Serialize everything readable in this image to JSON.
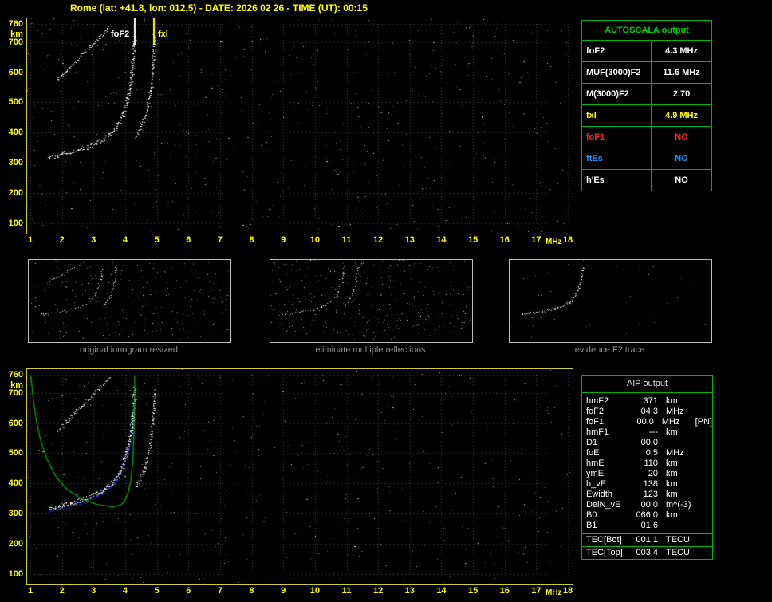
{
  "title": "Rome (lat: +41.8, lon: 012.5) - DATE: 2026 02 26 - TIME (UT): 00:15",
  "top_plot": {
    "foF2_label": "foF2",
    "fxl_label": "fxl",
    "x_unit": "MHz",
    "y_unit": "km"
  },
  "bottom_plot": {
    "x_unit": "MHz",
    "y_unit": "km"
  },
  "autoscala_table": {
    "title": "AUTOSCALA output",
    "rows": [
      {
        "label": "foF2",
        "value": "4.3 MHz",
        "color": "#ffffff"
      },
      {
        "label": "MUF(3000)F2",
        "value": "11.6 MHz",
        "color": "#ffffff"
      },
      {
        "label": "M(3000)F2",
        "value": "2.70",
        "color": "#ffffff"
      },
      {
        "label": "fxl",
        "value": "4.9 MHz",
        "color": "#ffff00"
      },
      {
        "label": "foF1",
        "value": "NO",
        "color": "#ff2222"
      },
      {
        "label": "ftEs",
        "value": "NO",
        "color": "#1e90ff"
      },
      {
        "label": "h'Es",
        "value": "NO",
        "color": "#ffffff"
      }
    ]
  },
  "mini_panels": [
    {
      "caption": "original ionogram resized"
    },
    {
      "caption": "eliminate multiple reflections"
    },
    {
      "caption": "evidence F2 trace"
    }
  ],
  "aip_table": {
    "title": "AIP output",
    "rows": [
      {
        "label": "hmF2",
        "value": "371",
        "unit": "km",
        "note": ""
      },
      {
        "label": "foF2",
        "value": "04.3",
        "unit": "MHz",
        "note": ""
      },
      {
        "label": "foF1",
        "value": "00.0",
        "unit": "MHz",
        "note": "[PN]"
      },
      {
        "label": "hmF1",
        "value": "---",
        "unit": "km",
        "note": ""
      },
      {
        "label": "D1",
        "value": "00.0",
        "unit": "",
        "note": ""
      },
      {
        "label": "foE",
        "value": "0.5",
        "unit": "MHz",
        "note": ""
      },
      {
        "label": "hmE",
        "value": "110",
        "unit": "km",
        "note": ""
      },
      {
        "label": "ymE",
        "value": "20",
        "unit": "km",
        "note": ""
      },
      {
        "label": "h_vE",
        "value": "138",
        "unit": "km",
        "note": ""
      },
      {
        "label": "Ewidth",
        "value": "123",
        "unit": "km",
        "note": ""
      },
      {
        "label": "DelN_vE",
        "value": "00.0",
        "unit": "m^(-3)",
        "note": ""
      },
      {
        "label": "B0",
        "value": "066.0",
        "unit": "km",
        "note": ""
      },
      {
        "label": "B1",
        "value": "01.6",
        "unit": "",
        "note": ""
      }
    ],
    "tec_rows": [
      {
        "label": "TEC[Bot]",
        "value": "001.1",
        "unit": "TECU"
      },
      {
        "label": "TEC[Top]",
        "value": "003.4",
        "unit": "TECU"
      }
    ]
  },
  "chart_data": {
    "type": "scatter",
    "xlabel": "MHz",
    "ylabel": "km",
    "x_range": [
      1,
      18
    ],
    "y_range": [
      100,
      760
    ],
    "x_ticks": [
      1,
      2,
      3,
      4,
      5,
      6,
      7,
      8,
      9,
      10,
      11,
      12,
      13,
      14,
      15,
      16,
      17,
      18
    ],
    "y_ticks": [
      760,
      700,
      600,
      500,
      400,
      300,
      200,
      100
    ],
    "foF2_MHz": 4.3,
    "fxl_MHz": 4.9,
    "MUF3000F2_MHz": 11.6,
    "M3000F2": 2.7,
    "traces": {
      "o_trace": [
        [
          1.55,
          318
        ],
        [
          1.8,
          323
        ],
        [
          2.1,
          330
        ],
        [
          2.4,
          339
        ],
        [
          2.7,
          350
        ],
        [
          3.0,
          363
        ],
        [
          3.3,
          379
        ],
        [
          3.55,
          399
        ],
        [
          3.75,
          424
        ],
        [
          3.9,
          456
        ],
        [
          4.02,
          496
        ],
        [
          4.12,
          541
        ],
        [
          4.2,
          592
        ],
        [
          4.25,
          642
        ],
        [
          4.28,
          692
        ],
        [
          4.3,
          722
        ]
      ],
      "x_trace": [
        [
          4.3,
          388
        ],
        [
          4.42,
          408
        ],
        [
          4.54,
          434
        ],
        [
          4.65,
          466
        ],
        [
          4.73,
          503
        ],
        [
          4.8,
          545
        ],
        [
          4.85,
          592
        ],
        [
          4.88,
          638
        ],
        [
          4.9,
          684
        ],
        [
          4.92,
          718
        ]
      ],
      "second_hop": [
        [
          1.85,
          575
        ],
        [
          2.1,
          602
        ],
        [
          2.4,
          633
        ],
        [
          2.7,
          665
        ],
        [
          3.0,
          697
        ],
        [
          3.3,
          729
        ],
        [
          3.55,
          755
        ]
      ],
      "profile": [
        [
          1.02,
          758
        ],
        [
          1.08,
          690
        ],
        [
          1.18,
          615
        ],
        [
          1.32,
          545
        ],
        [
          1.52,
          482
        ],
        [
          1.8,
          425
        ],
        [
          2.15,
          382
        ],
        [
          2.6,
          350
        ],
        [
          3.1,
          331
        ],
        [
          3.6,
          323
        ],
        [
          3.85,
          328
        ],
        [
          4.0,
          345
        ],
        [
          4.1,
          372
        ],
        [
          4.18,
          412
        ],
        [
          4.24,
          470
        ],
        [
          4.27,
          540
        ],
        [
          4.29,
          620
        ],
        [
          4.3,
          700
        ],
        [
          4.3,
          758
        ]
      ]
    }
  }
}
